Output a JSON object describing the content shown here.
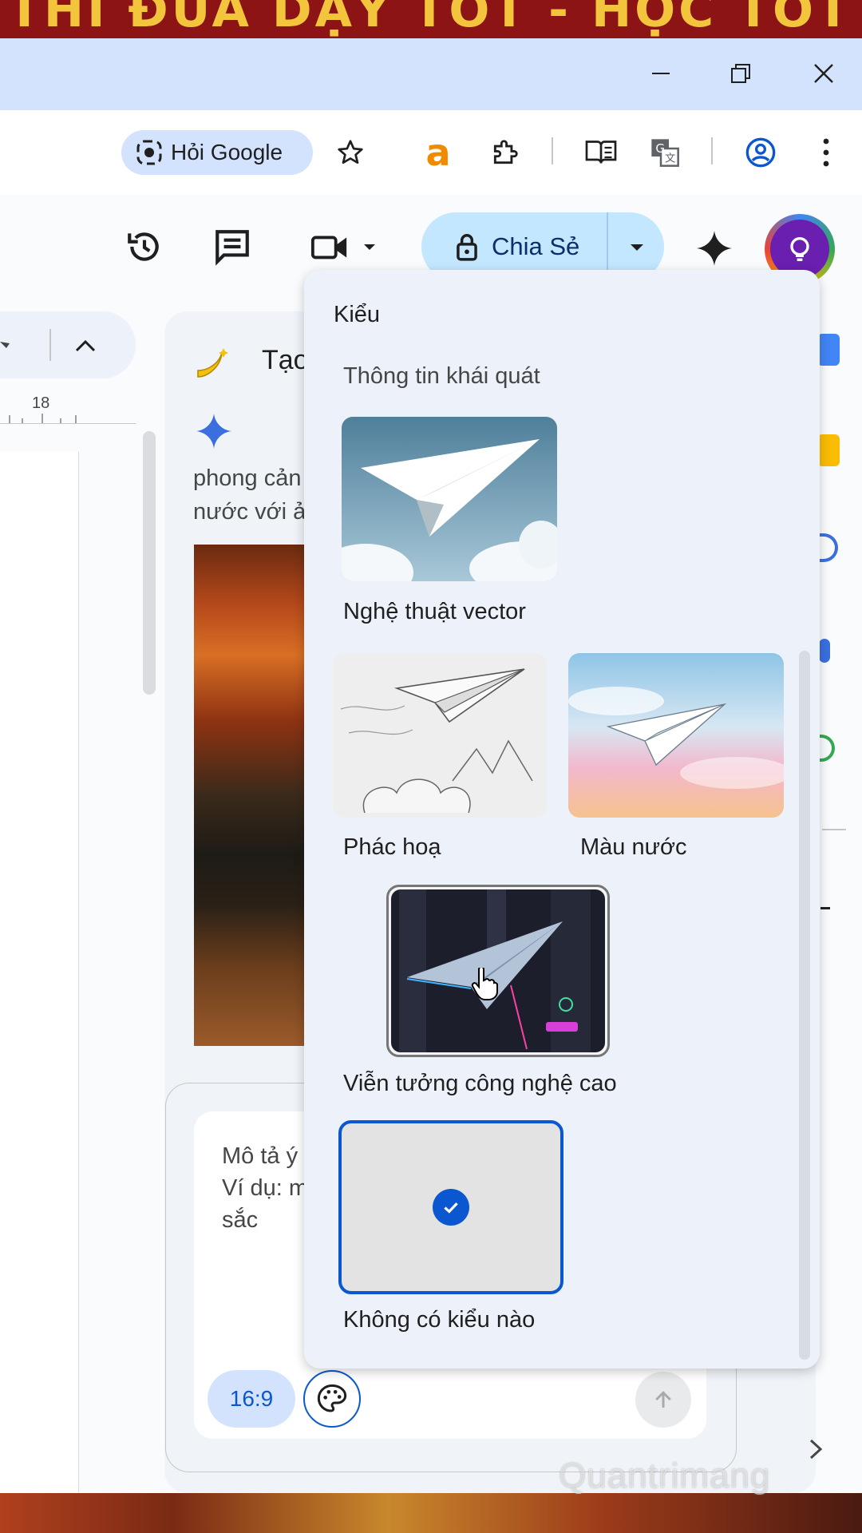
{
  "banner": {
    "text": "THI ĐUA DẠY TỐT - HỌC TỐT"
  },
  "toolbar": {
    "ask_google_label": "Hỏi Google"
  },
  "header": {
    "share_label": "Chia Sẻ"
  },
  "document": {
    "ruler_tick": "18"
  },
  "side_panel": {
    "title": "Tạo",
    "generated_text": "phong cản\nnước với ả",
    "prompt_placeholder": "Mô tả ý\nVí dụ: m\nsắc",
    "aspect_ratio": "16:9"
  },
  "style_menu": {
    "heading": "Kiểu",
    "section_label": "Thông tin khái quát",
    "options": [
      {
        "label": "Nghệ thuật vector"
      },
      {
        "label": "Phác hoạ"
      },
      {
        "label": "Màu nước"
      },
      {
        "label": "Viễn tưởng công nghệ cao"
      },
      {
        "label": "Không có kiểu nào",
        "selected": true
      }
    ]
  },
  "watermark": "Quantrimang",
  "colors": {
    "accent": "#0b57d0",
    "share_bg": "#c2e7ff",
    "menu_bg": "#edf2fa",
    "titlebar": "#d3e3fd"
  },
  "icons": [
    "minimize-icon",
    "restore-icon",
    "close-icon",
    "lens-icon",
    "star-icon",
    "amazon-icon",
    "extensions-icon",
    "reading-list-icon",
    "translate-icon",
    "profile-icon",
    "more-icon",
    "history-icon",
    "comment-icon",
    "video-icon",
    "lock-icon",
    "gemini-icon",
    "banana-icon",
    "palette-icon",
    "send-arrow-icon",
    "check-icon",
    "chevron-right-icon"
  ]
}
